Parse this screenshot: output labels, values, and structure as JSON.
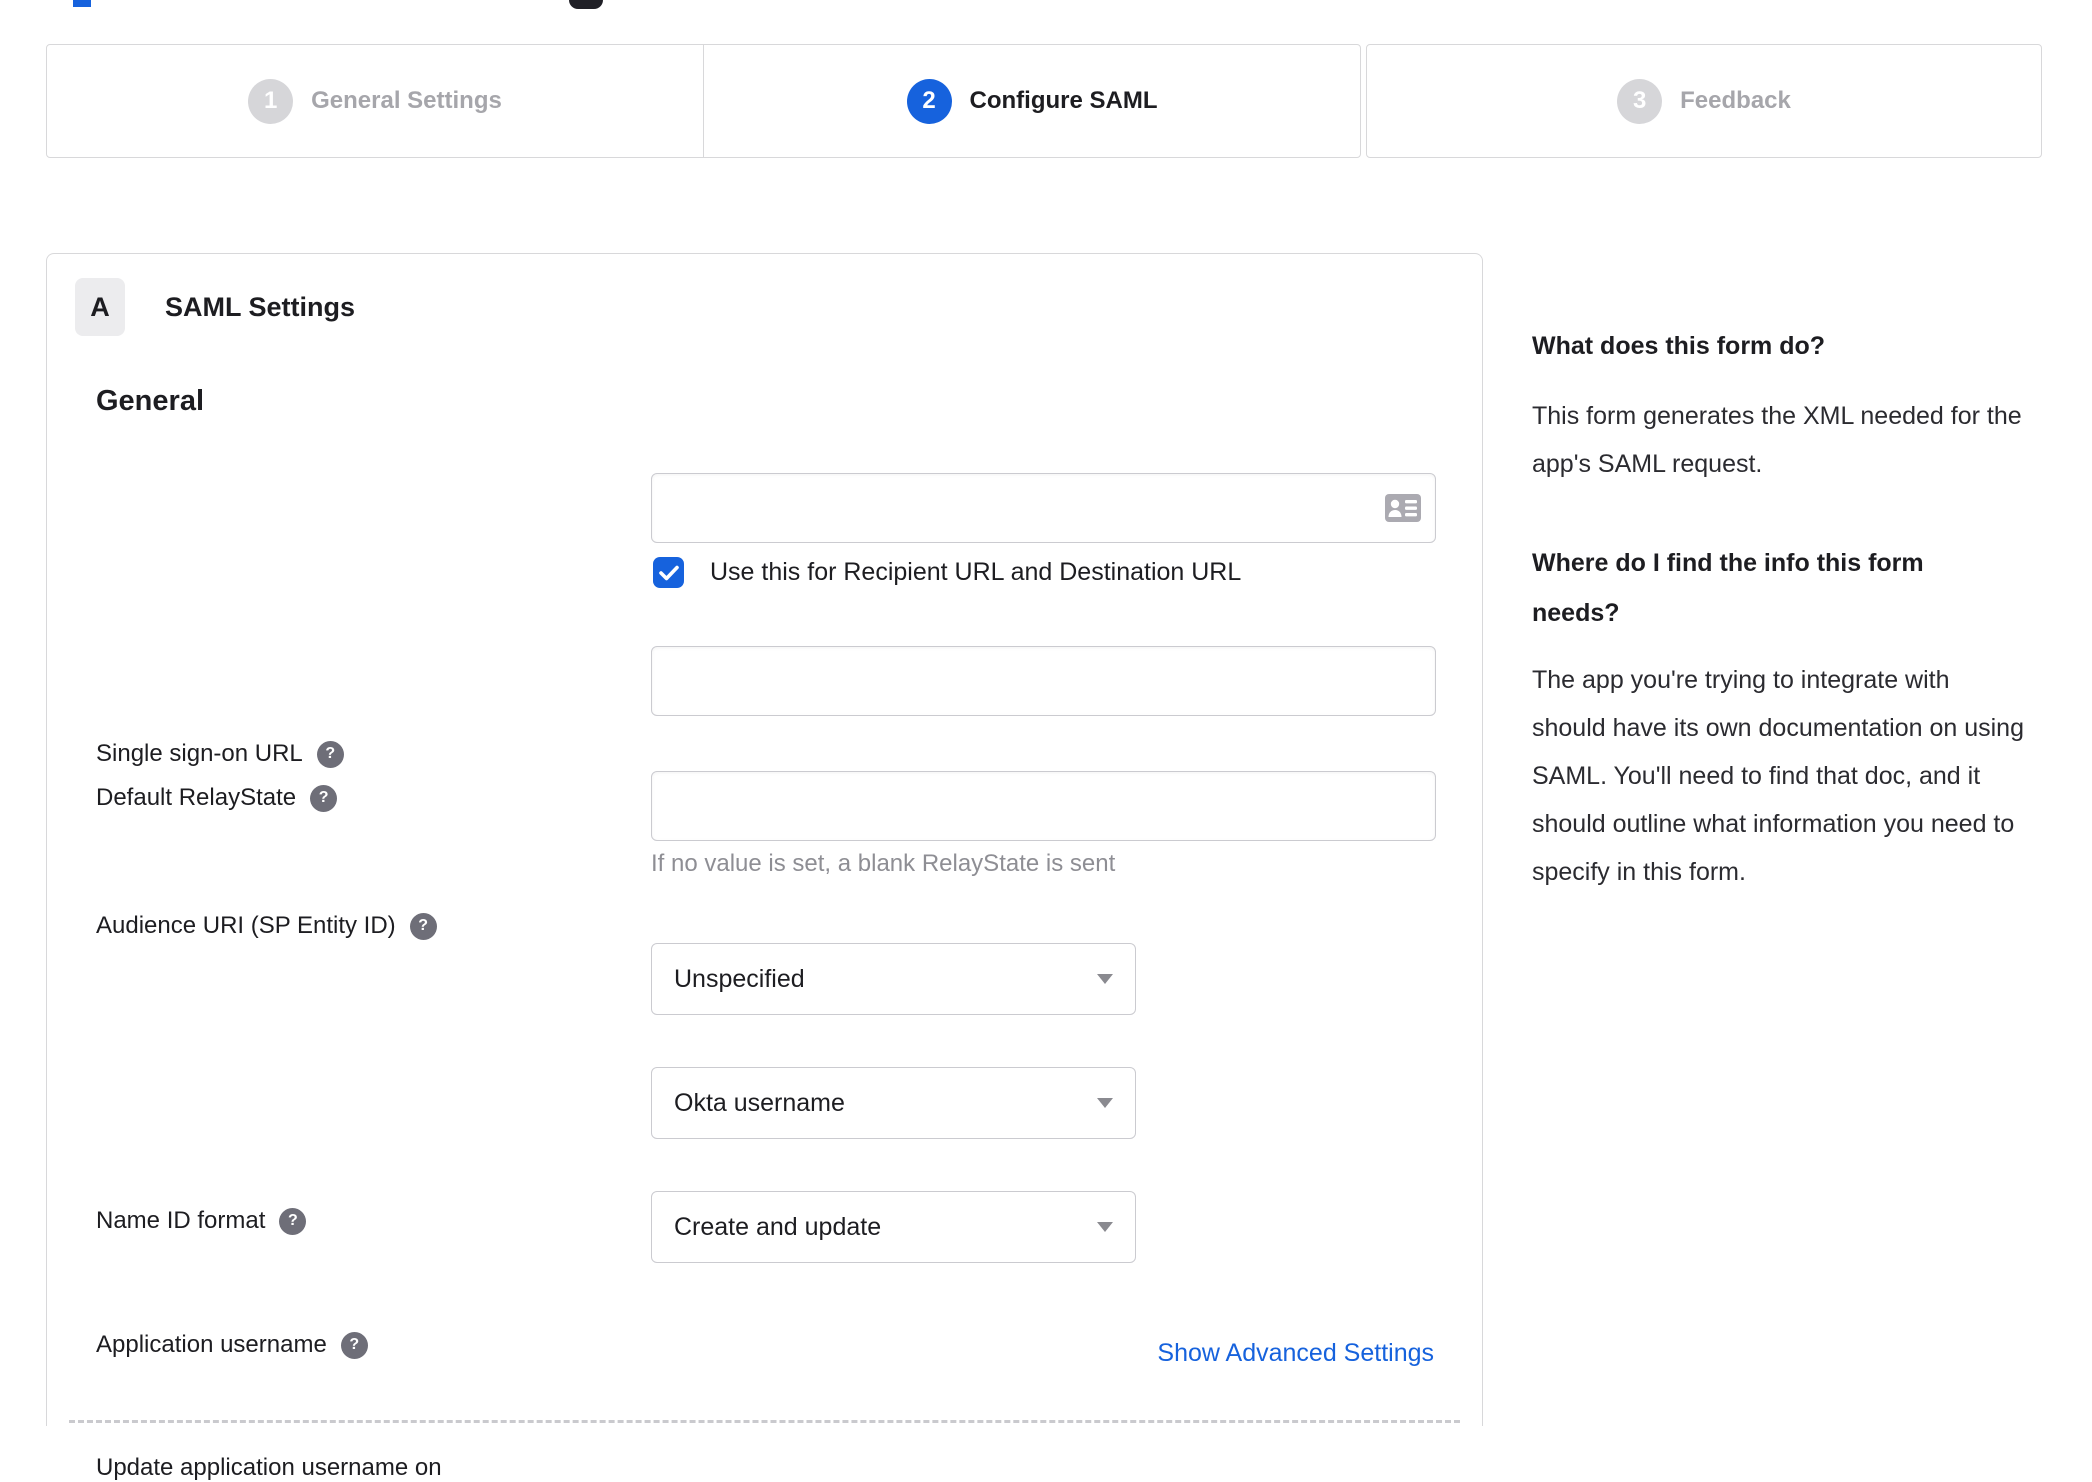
{
  "colors": {
    "accent": "#1662dd",
    "text": "#1d1d21",
    "muted_step": "#a6a6ab",
    "border": "#d8d8da",
    "hint": "#8e8e94"
  },
  "icons": {
    "help_glyph": "?",
    "input_trailing": "contact-card",
    "select_caret": "triangle-down",
    "checkbox_check": "checkmark"
  },
  "stepper": {
    "steps": [
      {
        "number": "1",
        "label": "General Settings",
        "state": "inactive"
      },
      {
        "number": "2",
        "label": "Configure SAML",
        "state": "active"
      },
      {
        "number": "3",
        "label": "Feedback",
        "state": "inactive"
      }
    ]
  },
  "panel": {
    "badge": "A",
    "title": "SAML Settings",
    "section": "General",
    "fields": {
      "sso_url": {
        "label": "Single sign-on URL",
        "value": "",
        "checkbox_checked": true,
        "checkbox_label": "Use this for Recipient URL and Destination URL"
      },
      "audience_uri": {
        "label": "Audience URI (SP Entity ID)",
        "value": ""
      },
      "relay_state": {
        "label": "Default RelayState",
        "value": "",
        "hint": "If no value is set, a blank RelayState is sent"
      },
      "name_id_format": {
        "label": "Name ID format",
        "value": "Unspecified"
      },
      "app_username": {
        "label": "Application username",
        "value": "Okta username"
      },
      "update_username": {
        "label": "Update application username on",
        "value": "Create and update"
      }
    },
    "advanced_link": "Show Advanced Settings"
  },
  "sidebar": {
    "blocks": [
      {
        "heading": "What does this form do?",
        "body": "This form generates the XML needed for the app's SAML request."
      },
      {
        "heading": "Where do I find the info this form needs?",
        "body": "The app you're trying to integrate with should have its own documentation on using SAML. You'll need to find that doc, and it should outline what information you need to specify in this form."
      }
    ]
  }
}
